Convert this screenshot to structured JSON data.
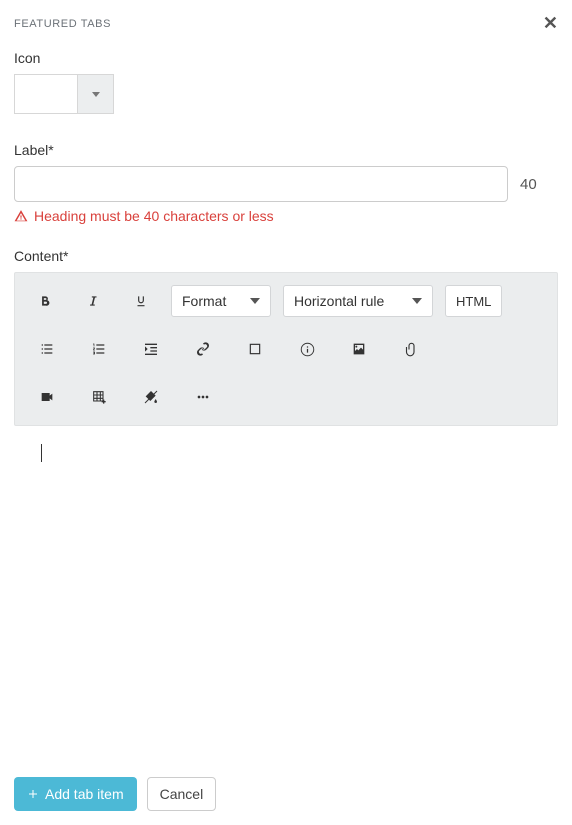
{
  "header": {
    "title": "FEATURED TABS"
  },
  "iconField": {
    "label": "Icon"
  },
  "labelField": {
    "label": "Label*",
    "value": "",
    "maxCount": "40",
    "errorText": "Heading must be 40 characters or less"
  },
  "contentField": {
    "label": "Content*"
  },
  "toolbar": {
    "format": "Format",
    "horizontalRule": "Horizontal rule",
    "htmlBtn": "HTML"
  },
  "footer": {
    "addLabel": "Add tab item",
    "cancelLabel": "Cancel"
  }
}
